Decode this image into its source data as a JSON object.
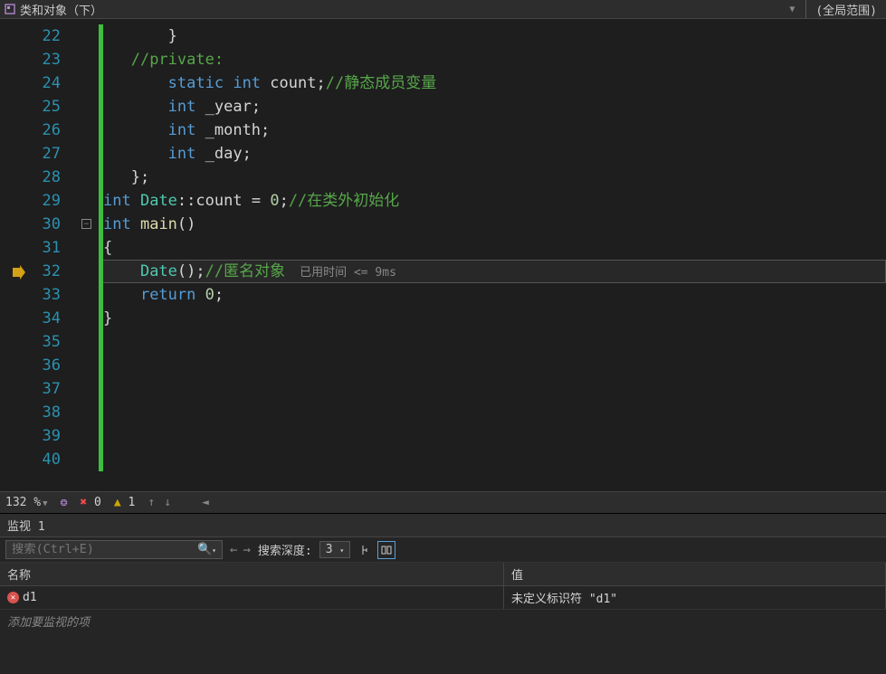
{
  "breadcrumb": {
    "file_label": "类和对象（下）",
    "scope_label": "(全局范围)"
  },
  "line_numbers": [
    "22",
    "23",
    "24",
    "25",
    "26",
    "27",
    "28",
    "29",
    "30",
    "31",
    "32",
    "33",
    "34",
    "35",
    "36",
    "37",
    "38",
    "39",
    "40"
  ],
  "code": {
    "l22": "}",
    "l23_comment": "//private:",
    "l24_kw_static": "static",
    "l24_kw_int": "int",
    "l24_id": "count",
    "l24_comment": "//静态成员变量",
    "l25_kw": "int",
    "l25_id": "_year",
    "l26_kw": "int",
    "l26_id": "_month",
    "l27_kw": "int",
    "l27_id": "_day",
    "l28": "};",
    "l29_kw": "int",
    "l29_cls": "Date",
    "l29_op": "::",
    "l29_id": "count",
    "l29_eq": " = ",
    "l29_val": "0",
    "l29_comment": "//在类外初始化",
    "l30_kw": "int",
    "l30_fn": "main",
    "l30_p": "()",
    "l31": "{",
    "l32_cls": "Date",
    "l32_p": "()",
    "l32_comment": "//匿名对象",
    "l32_hint": "已用时间 <= 9ms",
    "l33_kw": "return",
    "l33_val": "0",
    "l34": "}"
  },
  "status": {
    "zoom": "132 %",
    "error_count": "0",
    "warn_count": "1"
  },
  "watch": {
    "title": "监视 1",
    "search_placeholder": "搜索(Ctrl+E)",
    "depth_label": "搜索深度:",
    "depth_value": "3",
    "col_name": "名称",
    "col_value": "值",
    "row1_name": "d1",
    "row1_value": "未定义标识符 \"d1\"",
    "add_placeholder": "添加要监视的项"
  }
}
